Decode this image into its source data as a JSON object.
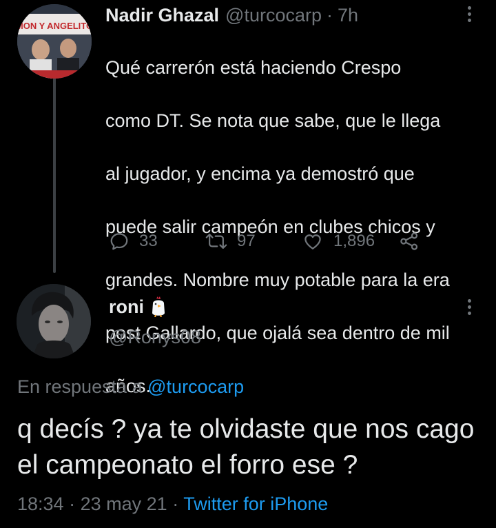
{
  "colors": {
    "background": "#000000",
    "text_primary": "#e7e9ea",
    "text_secondary": "#71767b",
    "accent": "#1d9bf0"
  },
  "parent_tweet": {
    "author_name": "Nadir Ghazal",
    "handle": "@turcocarp",
    "separator": "·",
    "time": "7h",
    "avatar_banner_text": "MON Y ANGELITO",
    "text": "Qué carrerón está haciendo Crespo como DT. Se nota que sabe, que le llega al jugador, y encima ya demostró que puede salir campeón en clubes chicos y grandes. Nombre muy potable para la era post Gallardo, que ojalá sea dentro de mil años.",
    "text_lines": [
      "Qué carrerón está haciendo Crespo",
      "como DT. Se nota que sabe, que le llega",
      "al jugador, y encima ya demostró que",
      "puede salir campeón en clubes chicos y",
      "grandes. Nombre muy potable para la era",
      "post Gallardo, que ojalá sea dentro de mil",
      "años."
    ],
    "actions": {
      "reply": {
        "icon": "reply-icon",
        "count": "33"
      },
      "retweet": {
        "icon": "retweet-icon",
        "count": "97"
      },
      "like": {
        "icon": "heart-icon",
        "count": "1,896"
      },
      "share": {
        "icon": "share-icon"
      }
    },
    "more_icon": "more-vertical-icon"
  },
  "reply_tweet": {
    "author_name": "roni",
    "name_emoji": "chicken-emoji",
    "handle": "@Ronys08",
    "more_icon": "more-vertical-icon",
    "in_reply_prefix": "En respuesta a",
    "in_reply_handle": "@turcocarp",
    "text": "q decís ? ya te olvidaste que nos cago el campeonato el forro ese ?",
    "time": "18:34",
    "dot1": "·",
    "date": "23 may 21",
    "dot2": "·",
    "source": "Twitter for iPhone"
  }
}
